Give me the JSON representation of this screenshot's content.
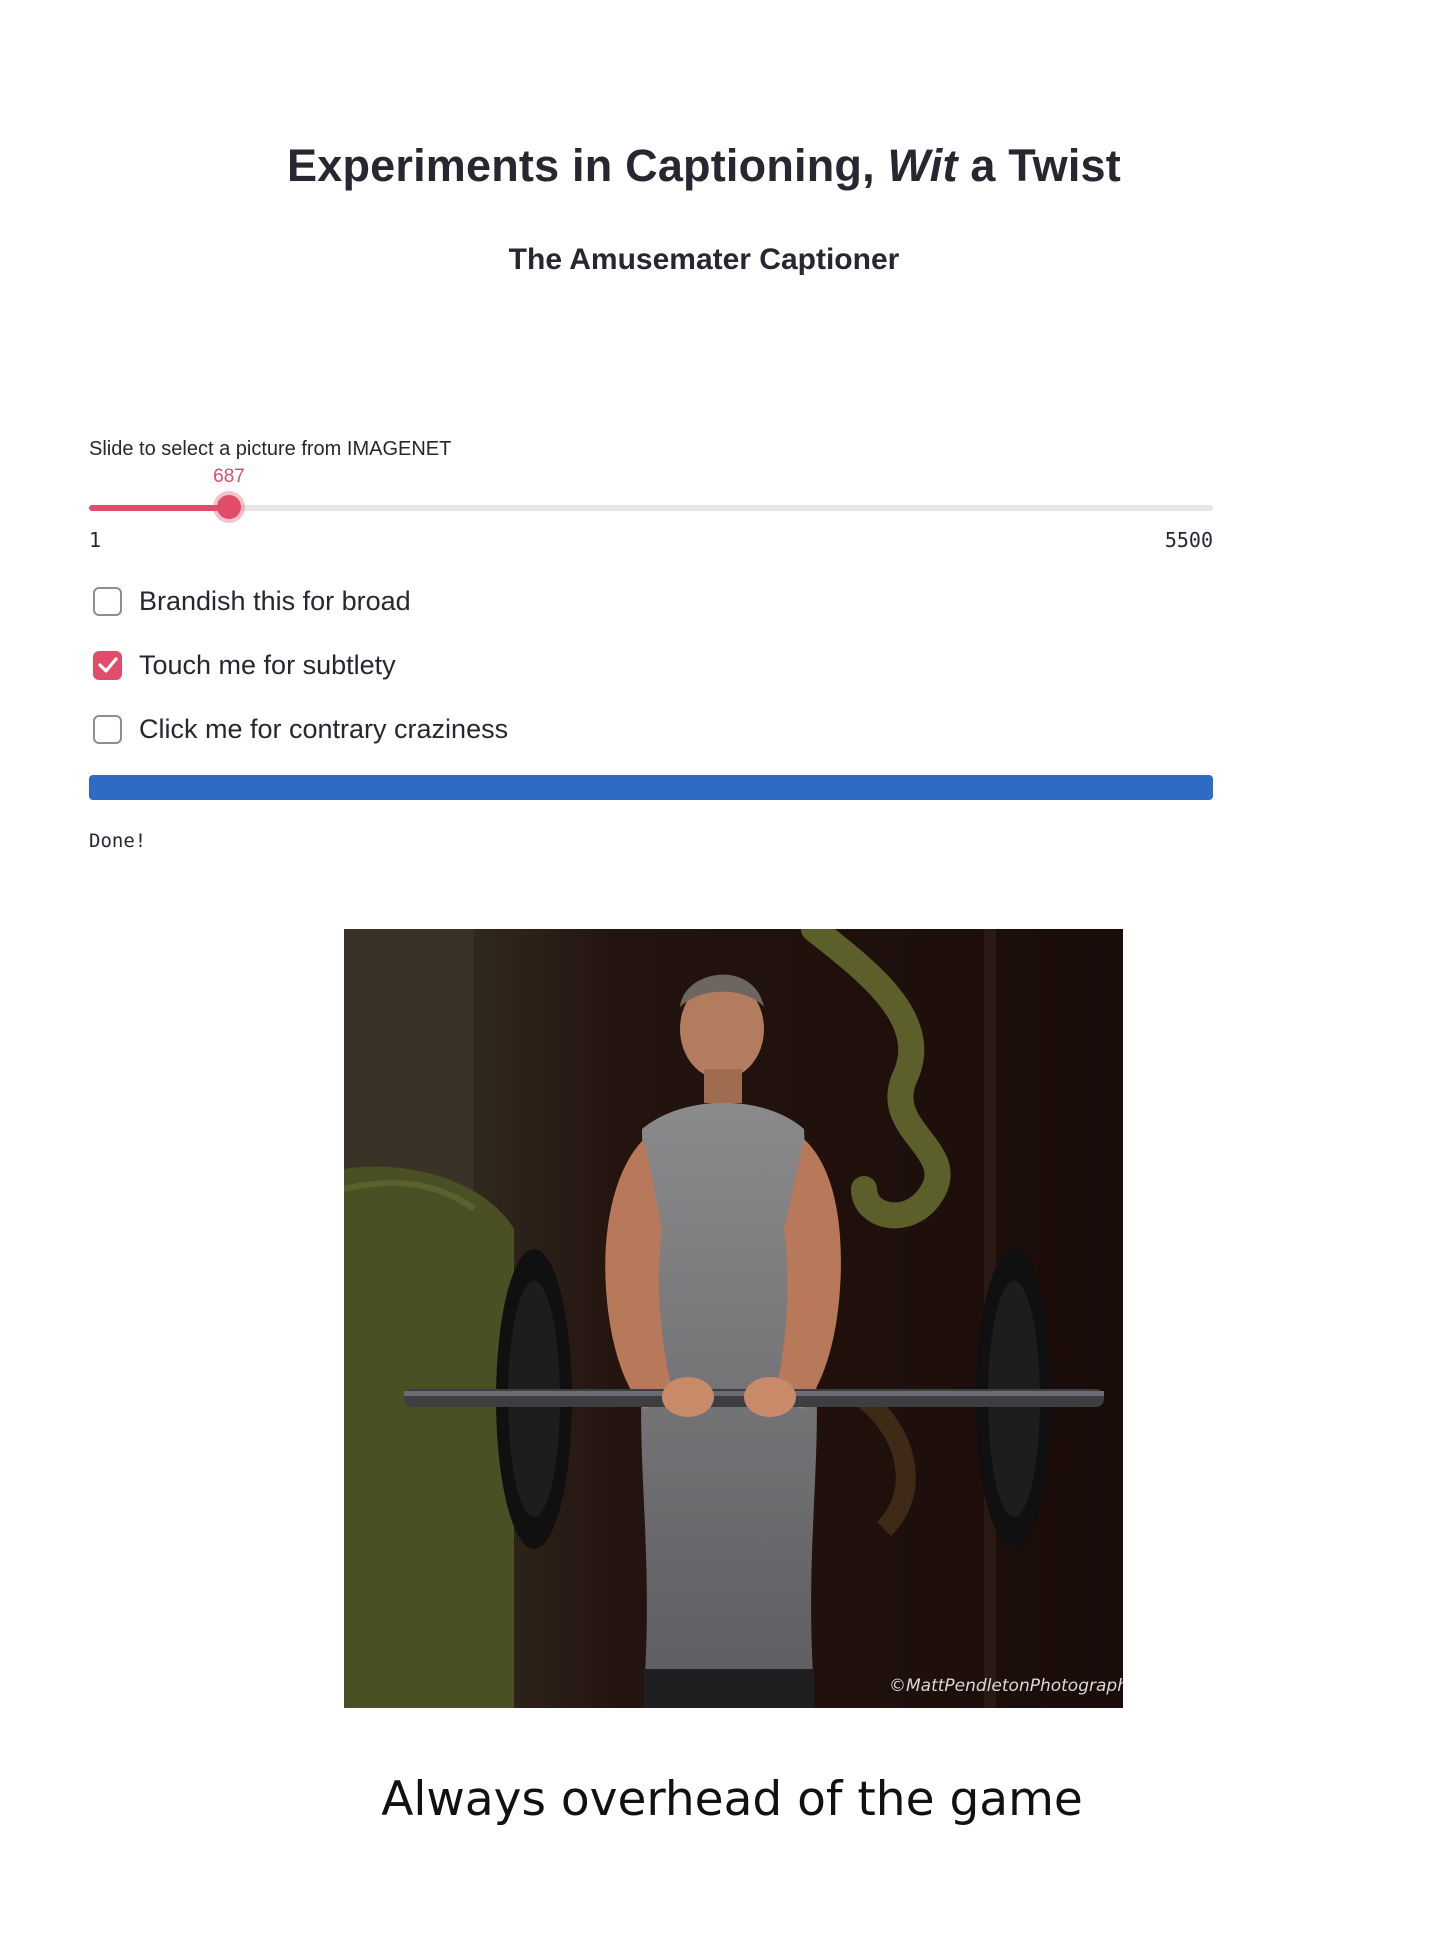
{
  "header": {
    "title_part1": "Experiments in Captioning, ",
    "title_italic": "Wit",
    "title_part2": " a Twist",
    "subtitle": "The Amusemater Captioner"
  },
  "slider": {
    "label": "Slide to select a picture from IMAGENET",
    "value": "687",
    "min": "1",
    "max": "5500",
    "fill_fraction": 0.1248
  },
  "checkboxes": [
    {
      "label": "Brandish this for broad",
      "checked": false
    },
    {
      "label": "Touch me for subtlety",
      "checked": true
    },
    {
      "label": "Click me for contrary craziness",
      "checked": false
    }
  ],
  "progress": {
    "percent": 100
  },
  "status": {
    "text": "Done!"
  },
  "image": {
    "watermark": "©MattPendletonPhotography"
  },
  "caption": "Always overhead of the game",
  "colors": {
    "accent": "#e14c6a",
    "progress": "#2e6bc5",
    "text": "#262730"
  }
}
